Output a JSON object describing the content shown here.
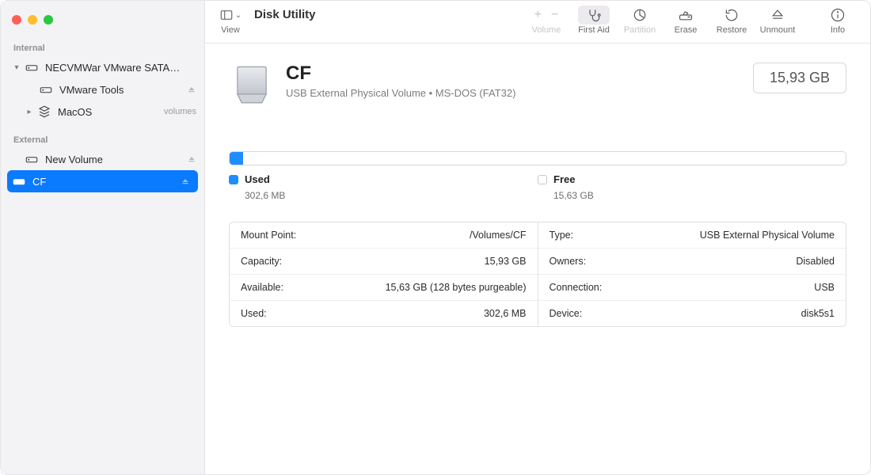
{
  "app": {
    "title": "Disk Utility",
    "view_caption": "View"
  },
  "toolbar": {
    "volume": "Volume",
    "first_aid": "First Aid",
    "partition": "Partition",
    "erase": "Erase",
    "restore": "Restore",
    "unmount": "Unmount",
    "info": "Info"
  },
  "sidebar": {
    "sections": {
      "internal": "Internal",
      "external": "External"
    },
    "internal": [
      {
        "label": "NECVMWar VMware SATA…",
        "expanded": true,
        "children": [
          {
            "label": "VMware Tools",
            "ejectable": true
          }
        ]
      },
      {
        "label": "MacOS",
        "suffix": "volumes",
        "expanded": false
      }
    ],
    "external": [
      {
        "label": "New Volume",
        "ejectable": true
      },
      {
        "label": "CF",
        "ejectable": true,
        "selected": true
      }
    ]
  },
  "volume": {
    "name": "CF",
    "subtitle": "USB External Physical Volume • MS-DOS (FAT32)",
    "capacity_badge": "15,93 GB",
    "usage": {
      "used_label": "Used",
      "used_value": "302,6 MB",
      "free_label": "Free",
      "free_value": "15,63 GB"
    },
    "left": [
      {
        "k": "Mount Point:",
        "v": "/Volumes/CF"
      },
      {
        "k": "Capacity:",
        "v": "15,93 GB"
      },
      {
        "k": "Available:",
        "v": "15,63 GB (128 bytes purgeable)"
      },
      {
        "k": "Used:",
        "v": "302,6 MB"
      }
    ],
    "right": [
      {
        "k": "Type:",
        "v": "USB External Physical Volume"
      },
      {
        "k": "Owners:",
        "v": "Disabled"
      },
      {
        "k": "Connection:",
        "v": "USB"
      },
      {
        "k": "Device:",
        "v": "disk5s1"
      }
    ]
  }
}
